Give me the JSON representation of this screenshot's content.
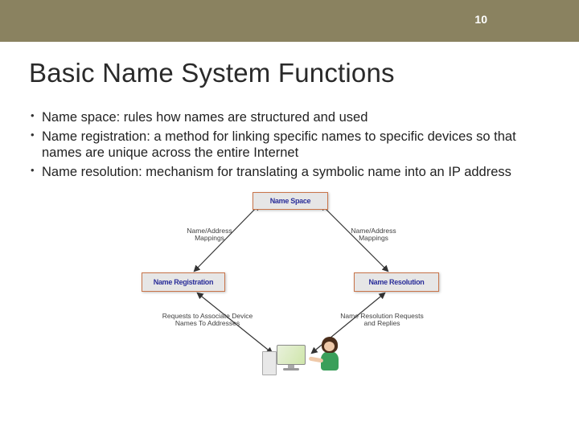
{
  "header": {
    "slide_number": "10"
  },
  "title": "Basic Name System Functions",
  "bullets": [
    "Name space:  rules how names are structured and used",
    "Name registration:  a method for linking specific names to specific devices so that names are unique across the entire Internet",
    "Name resolution:  mechanism for translating a symbolic name into an IP address"
  ],
  "diagram": {
    "box_namespace": "Name Space",
    "box_registration": "Name Registration",
    "box_resolution": "Name Resolution",
    "label_mappings_left": "Name/Address Mappings",
    "label_mappings_right": "Name/Address Mappings",
    "label_requests_left": "Requests to Associate Device Names To Addresses",
    "label_requests_right": "Name Resolution Requests and Replies"
  }
}
